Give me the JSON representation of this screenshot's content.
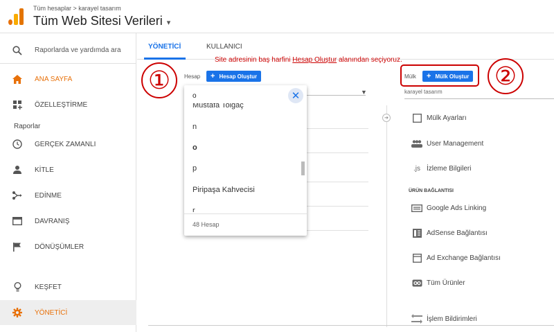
{
  "header": {
    "breadcrumb": "Tüm hesaplar > karayel tasarım",
    "title": "Tüm Web Sitesi Verileri",
    "caret": "▾"
  },
  "sidebar": {
    "search_placeholder": "Raporlarda ve yardımda ara",
    "home": "ANA SAYFA",
    "customization": "ÖZELLEŞTİRME",
    "reports_label": "Raporlar",
    "realtime": "GERÇEK ZAMANLI",
    "audience": "KİTLE",
    "acquisition": "EDİNME",
    "behavior": "DAVRANIŞ",
    "conversions": "DÖNÜŞÜMLER",
    "discover": "KEŞFET",
    "admin": "YÖNETİCİ"
  },
  "tabs": {
    "admin": "YÖNETİCİ",
    "user": "KULLANICI"
  },
  "annotation": {
    "before": "Site adresinin baş harfini ",
    "link": "Hesap Oluştur",
    "after": " alanından seçiyoruz."
  },
  "account": {
    "label": "Hesap",
    "create_button": "Hesap Oluştur",
    "step_number": "①"
  },
  "dropdown": {
    "search_value": "o",
    "items": [
      "Mustafa Tolgaç",
      "n",
      "o",
      "p",
      "Piripaşa Kahvecisi",
      "r"
    ],
    "count": "48 Hesap"
  },
  "property": {
    "label": "Mülk",
    "create_button": "Mülk Oluştur",
    "name": "karayel tasarım",
    "step_number": "②",
    "items": {
      "settings": "Mülk Ayarları",
      "user_management": "User Management",
      "tracking_info": "İzleme Bilgileri",
      "section_product_linking": "ÜRÜN BAĞLANTISI",
      "google_ads": "Google Ads Linking",
      "adsense": "AdSense Bağlantısı",
      "ad_exchange": "Ad Exchange Bağlantısı",
      "all_products": "Tüm Ürünler",
      "postbacks": "İşlem Bildirimleri"
    }
  },
  "colors": {
    "accent_orange": "#e8710a",
    "primary_blue": "#1a73e8",
    "annotation_red": "#cc0000"
  }
}
